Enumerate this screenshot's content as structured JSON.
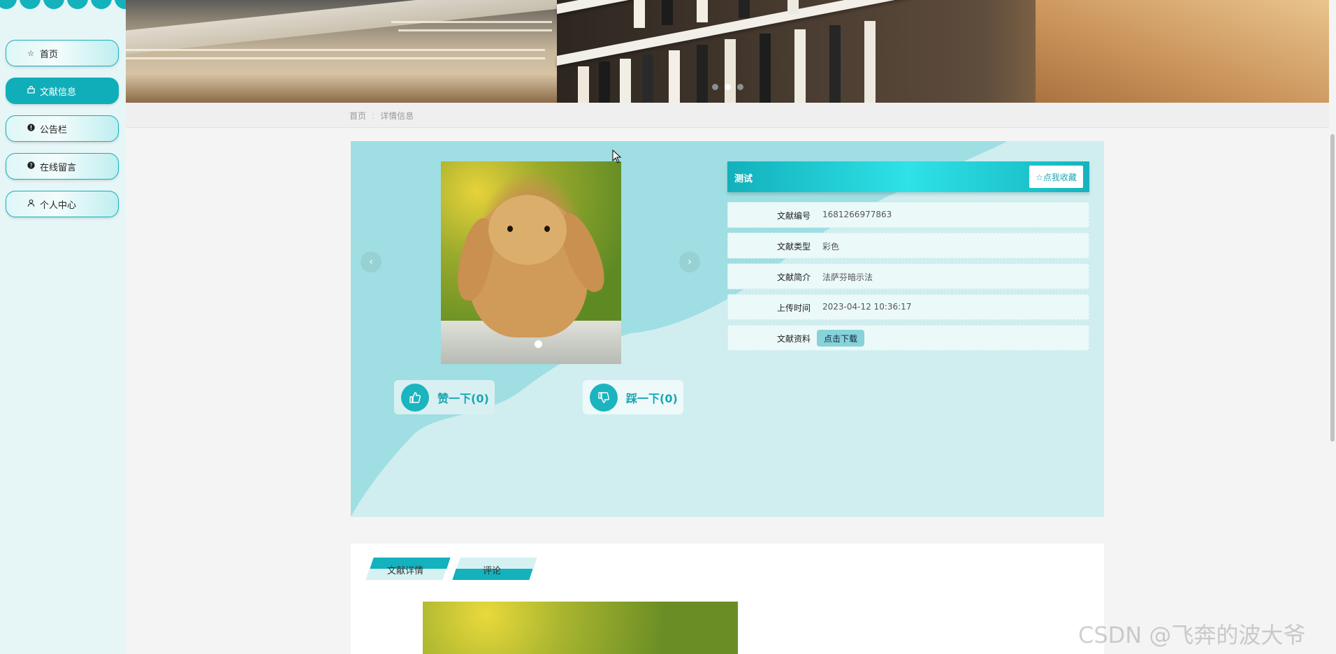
{
  "sidebar": {
    "items": [
      {
        "label": "首页",
        "icon": "star-icon",
        "active": false
      },
      {
        "label": "文献信息",
        "icon": "bag-icon",
        "active": true
      },
      {
        "label": "公告栏",
        "icon": "exclamation-circle-icon",
        "active": false
      },
      {
        "label": "在线留言",
        "icon": "question-circle-icon",
        "active": false
      },
      {
        "label": "个人中心",
        "icon": "user-icon",
        "active": false
      }
    ]
  },
  "breadcrumb": {
    "home": "首页",
    "separator": ":",
    "current": "详情信息"
  },
  "detail": {
    "title": "测试",
    "favorite_label": "☆点我收藏",
    "fields": [
      {
        "key": "文献编号",
        "value": "1681266977863"
      },
      {
        "key": "文献类型",
        "value": "彩色"
      },
      {
        "key": "文献简介",
        "value": "法萨芬暗示法"
      },
      {
        "key": "上传时间",
        "value": "2023-04-12 10:36:17"
      }
    ],
    "download": {
      "key": "文献资料",
      "button_label": "点击下载"
    },
    "prev_arrow": "‹",
    "next_arrow": "›",
    "like_label": "赞一下(0)",
    "dislike_label": "踩一下(0)"
  },
  "tabs": [
    {
      "label": "文献详情",
      "active": true
    },
    {
      "label": "评论",
      "active": false
    }
  ],
  "watermark": "CSDN @飞奔的波大爷",
  "colors": {
    "accent": "#13b2bd",
    "sidebar_bg": "#e6f6f7",
    "panel_bg": "#d0eeef"
  }
}
